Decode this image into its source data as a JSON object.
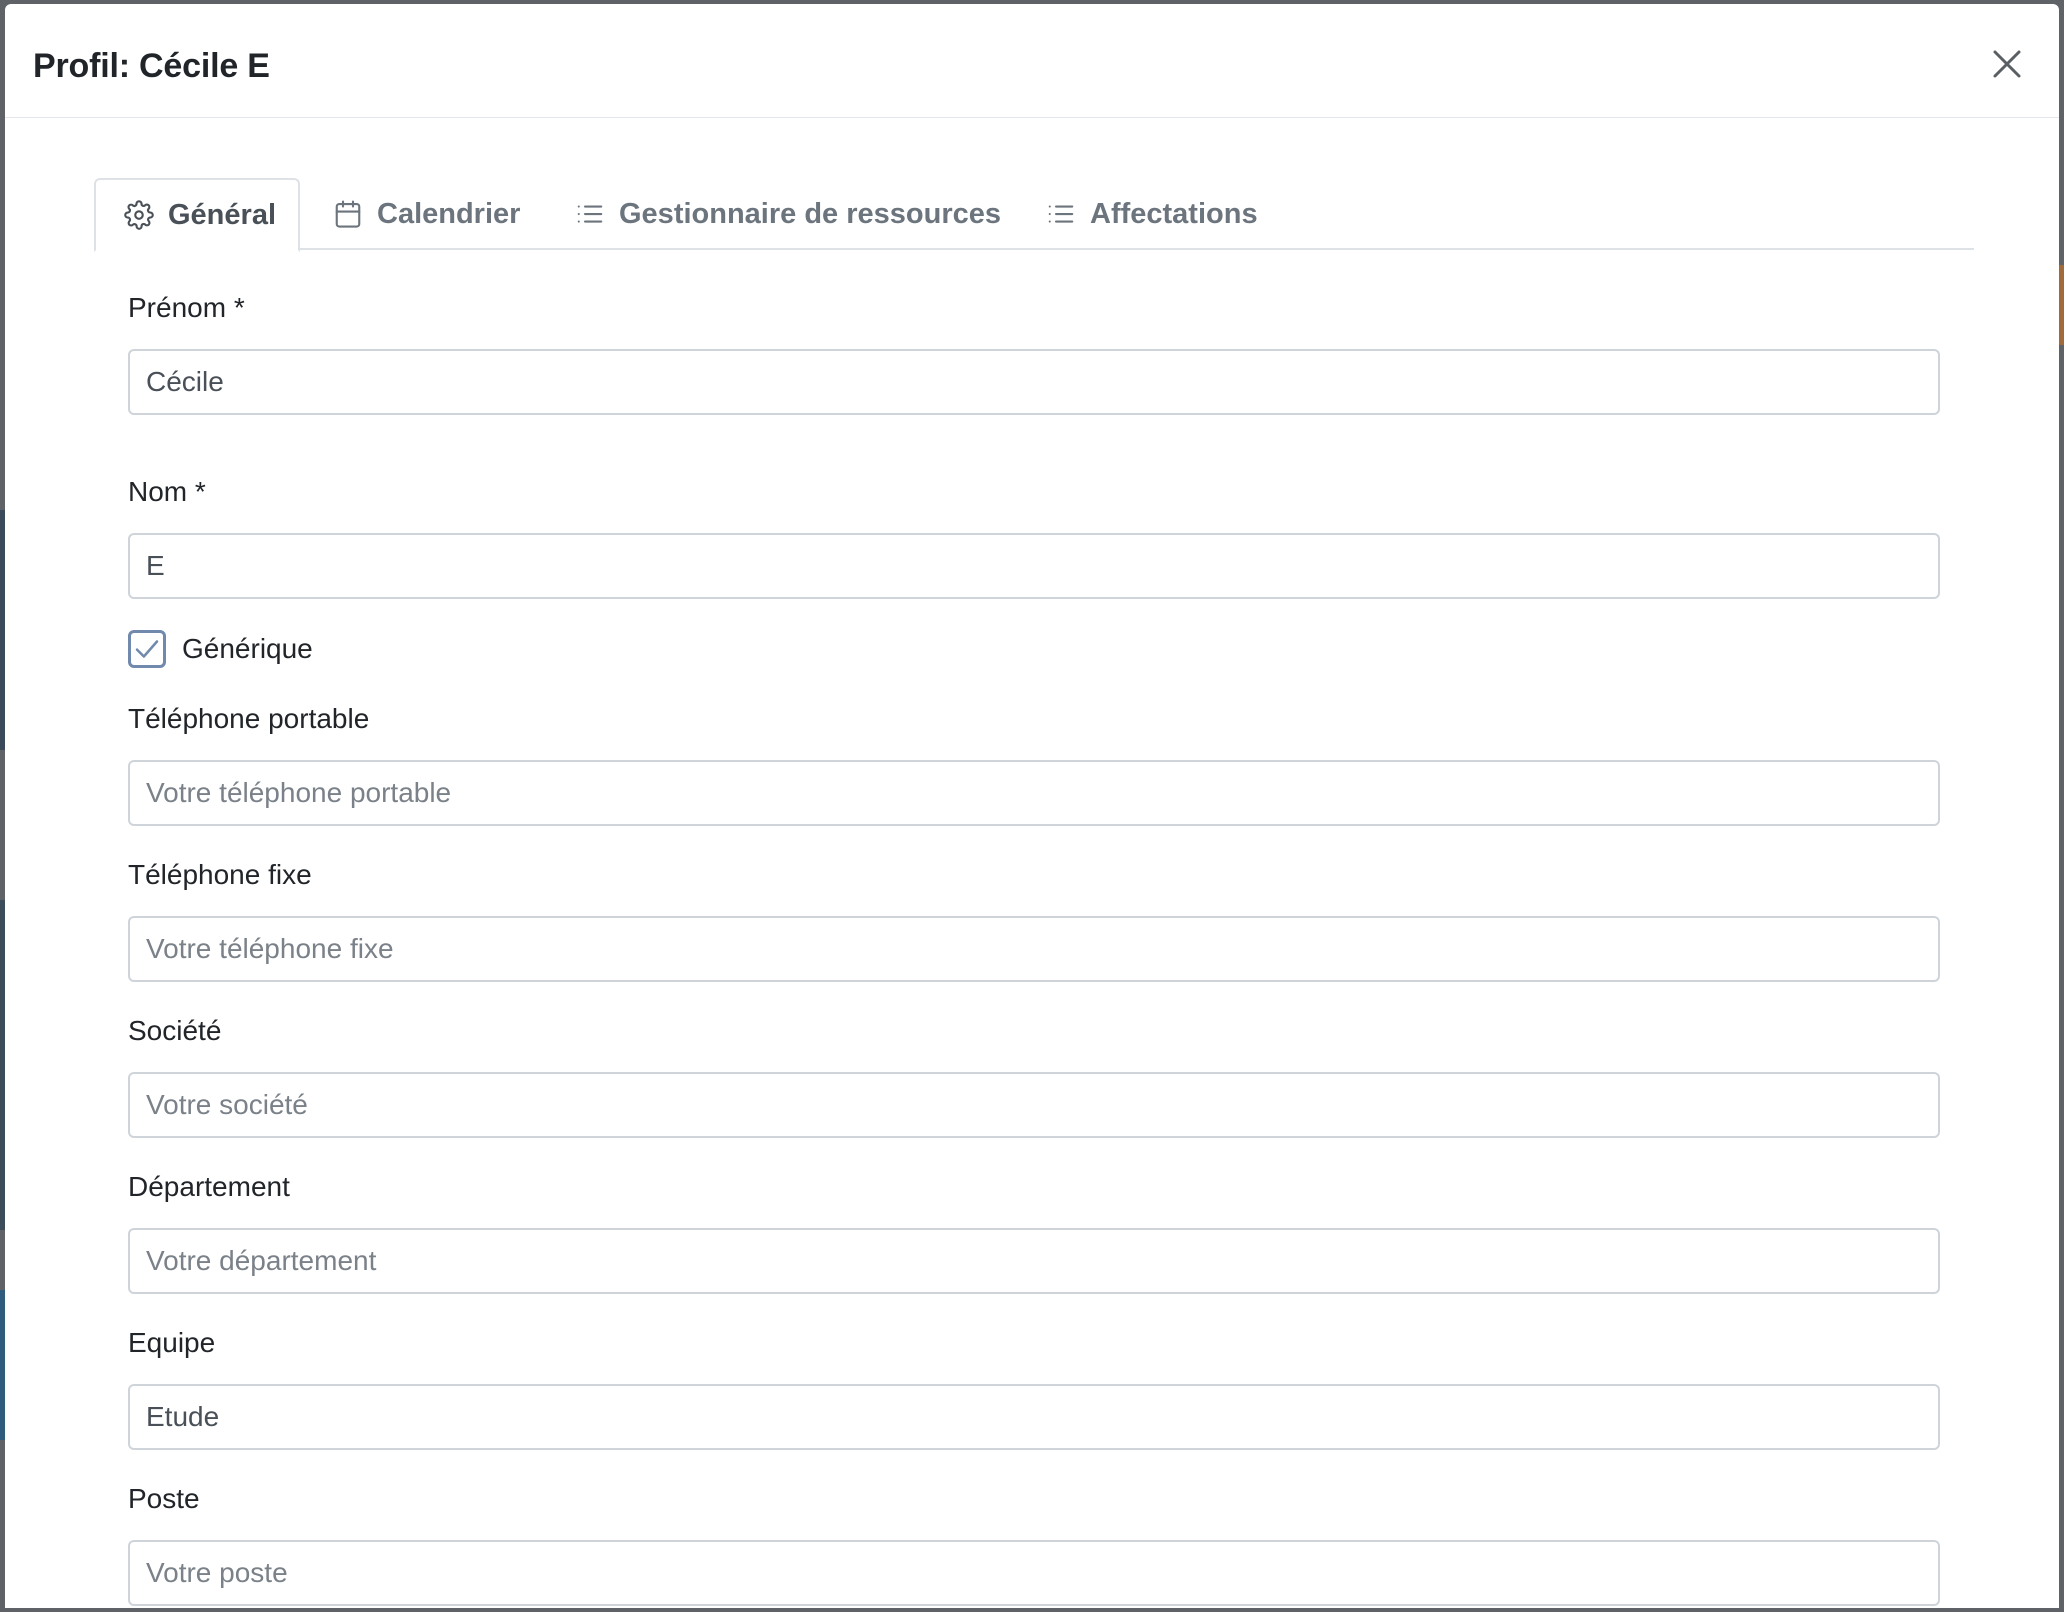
{
  "modal": {
    "title": "Profil: Cécile E"
  },
  "tabs": [
    {
      "label": "Général",
      "icon": "gear-icon",
      "active": true
    },
    {
      "label": "Calendrier",
      "icon": "calendar-icon",
      "active": false
    },
    {
      "label": "Gestionnaire de ressources",
      "icon": "list-icon",
      "active": false
    },
    {
      "label": "Affectations",
      "icon": "list-icon",
      "active": false
    }
  ],
  "form": {
    "prenom": {
      "label": "Prénom *",
      "value": "Cécile",
      "placeholder": ""
    },
    "nom": {
      "label": "Nom *",
      "value": "E",
      "placeholder": ""
    },
    "generique": {
      "label": "Générique",
      "checked": true
    },
    "telephone_portable": {
      "label": "Téléphone portable",
      "value": "",
      "placeholder": "Votre téléphone portable"
    },
    "telephone_fixe": {
      "label": "Téléphone fixe",
      "value": "",
      "placeholder": "Votre téléphone fixe"
    },
    "societe": {
      "label": "Société",
      "value": "",
      "placeholder": "Votre société"
    },
    "departement": {
      "label": "Département",
      "value": "",
      "placeholder": "Votre département"
    },
    "equipe": {
      "label": "Equipe",
      "value": "Etude",
      "placeholder": ""
    },
    "poste": {
      "label": "Poste",
      "value": "",
      "placeholder": "Votre poste"
    }
  },
  "colors": {
    "accent_checkbox": "#7089ad",
    "border": "#ced4da",
    "tab_border": "#dee2e6",
    "text": "#212529",
    "muted": "#6c757d"
  }
}
